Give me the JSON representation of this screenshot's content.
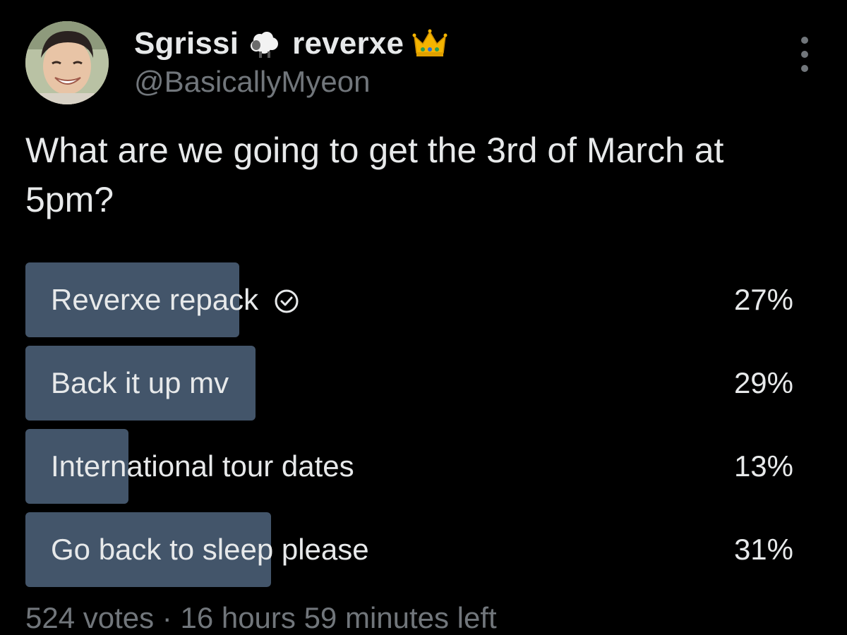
{
  "user": {
    "display_name": "Sgrissi",
    "display_name_suffix": "reverxe",
    "emoji_1": "sheep-emoji",
    "emoji_2": "crown-emoji",
    "handle": "@BasicallyMyeon"
  },
  "tweet": {
    "text": "What are we going to get the 3rd of March at 5pm?"
  },
  "poll": {
    "options": [
      {
        "label": "Reverxe repack",
        "percent": "27%",
        "fraction": 0.27,
        "selected": true
      },
      {
        "label": "Back it up mv",
        "percent": "29%",
        "fraction": 0.29,
        "selected": false
      },
      {
        "label": "International tour dates",
        "percent": "13%",
        "fraction": 0.13,
        "selected": false
      },
      {
        "label": "Go back to sleep please",
        "percent": "31%",
        "fraction": 0.31,
        "selected": false
      }
    ],
    "footer": "524 votes · 16 hours 59 minutes left"
  },
  "colors": {
    "background": "#000000",
    "text": "#e7e9ea",
    "secondary_text": "#71767b",
    "poll_bar": "#43556a"
  }
}
